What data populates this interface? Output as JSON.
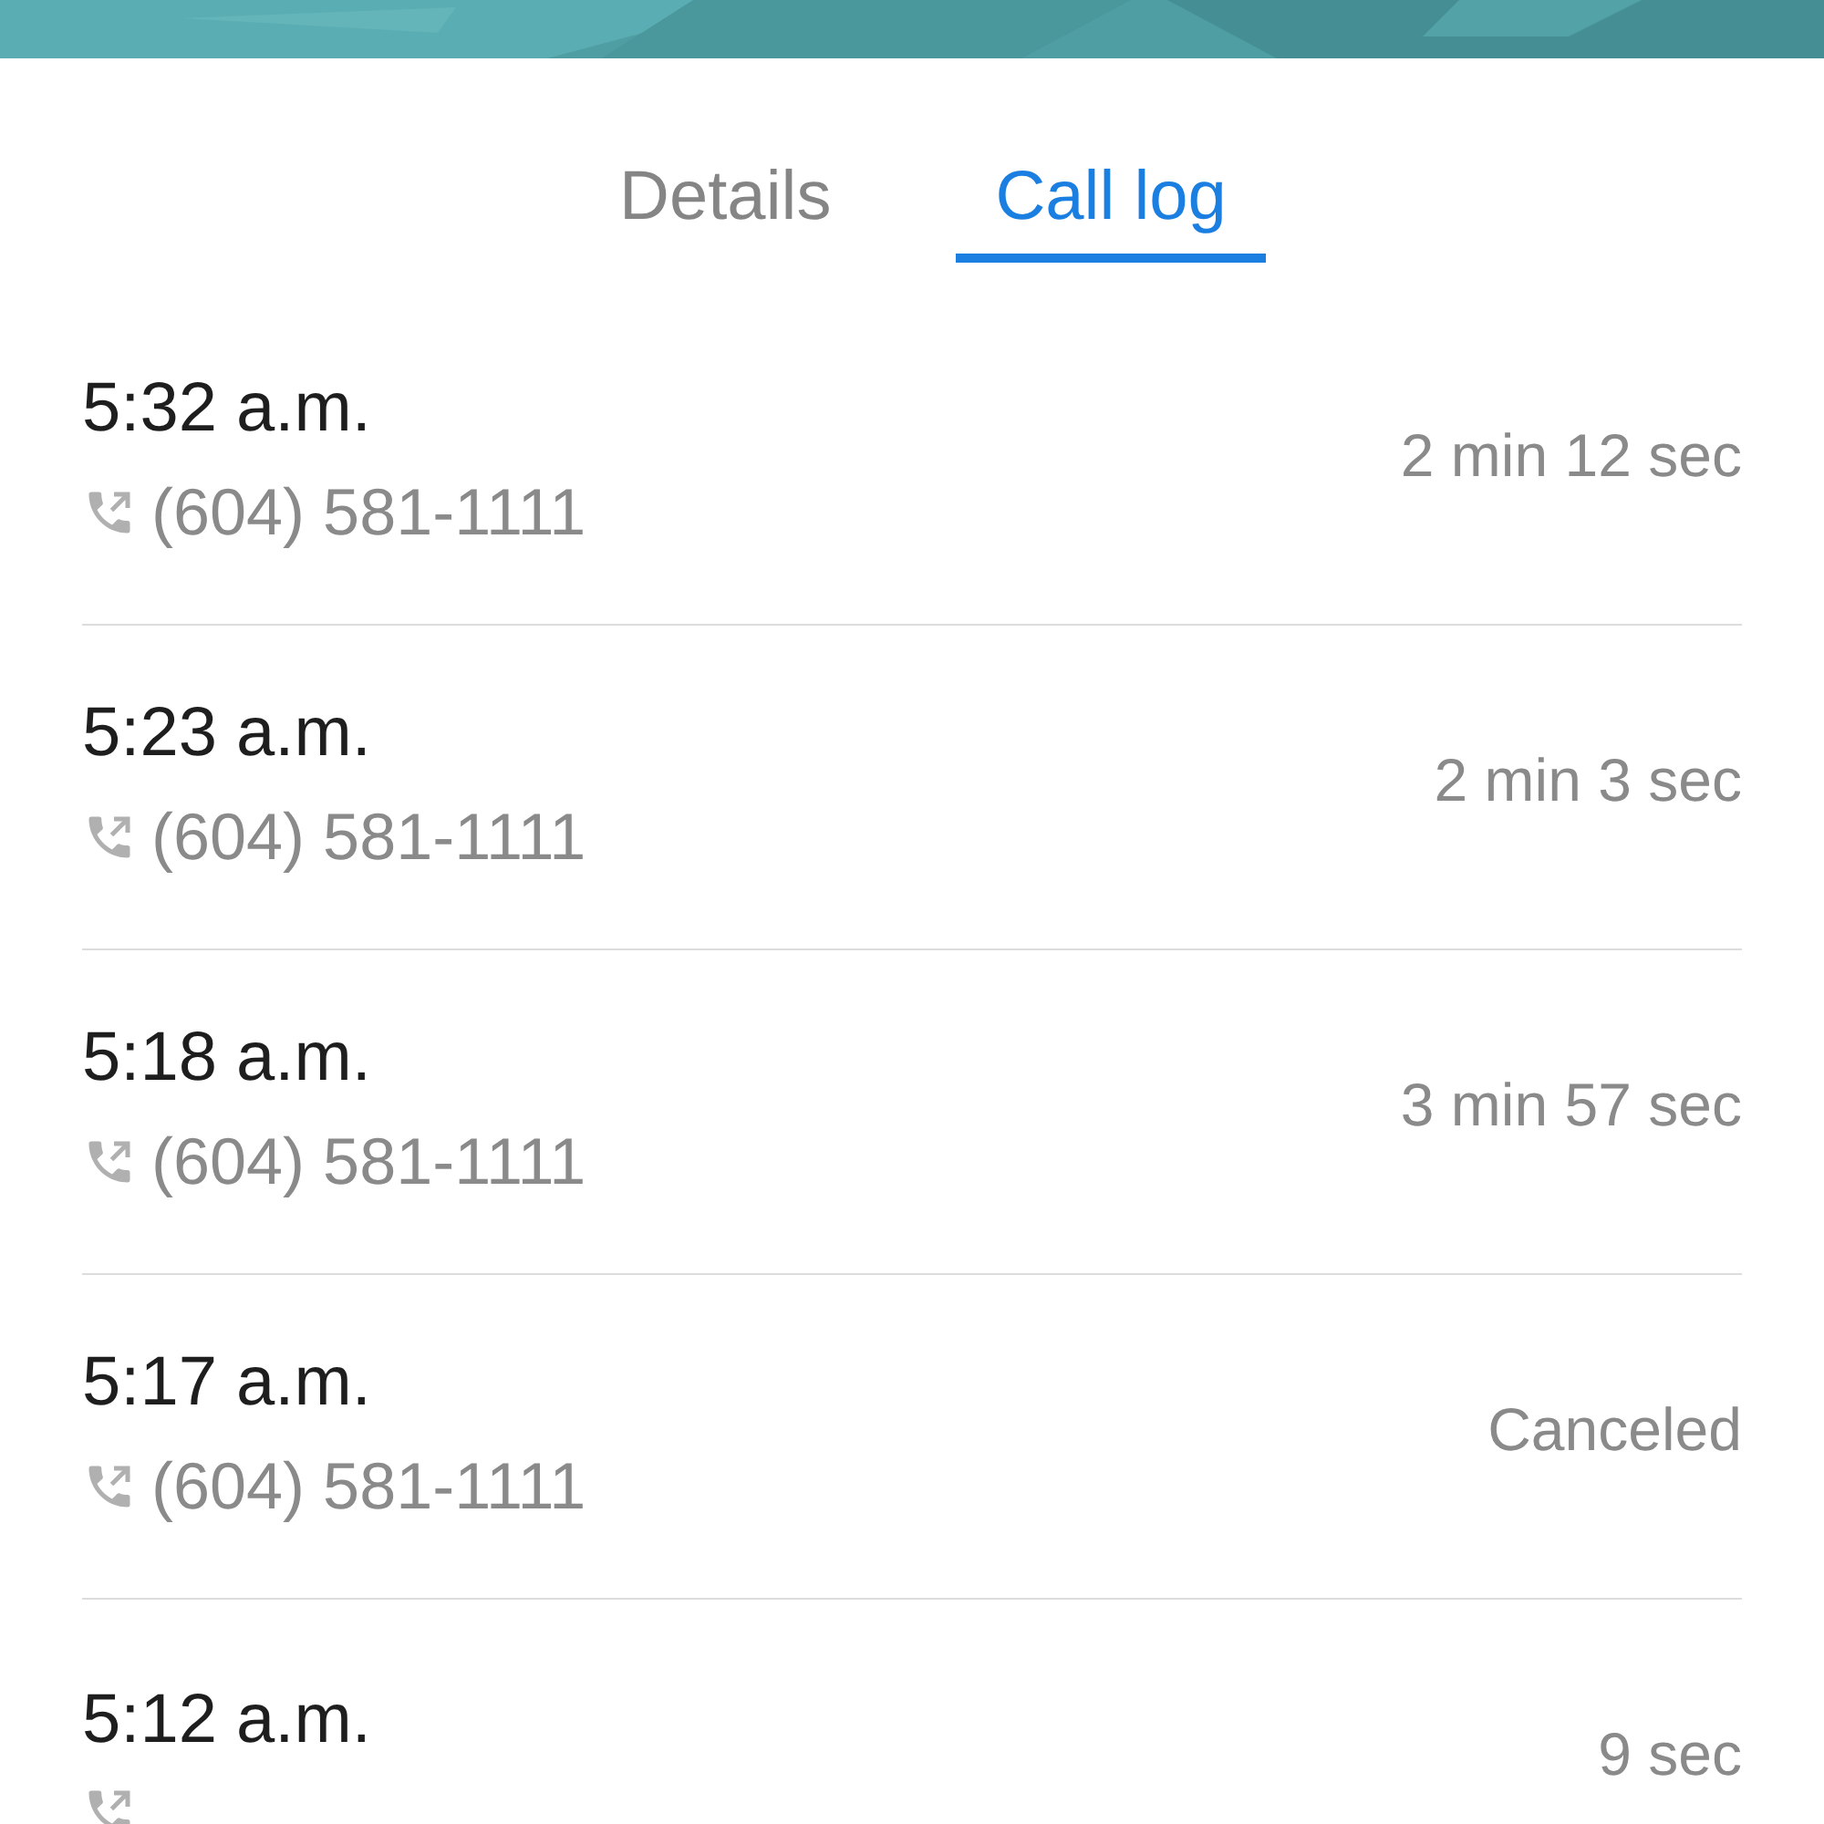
{
  "tabs": [
    {
      "label": "Details",
      "selected": false
    },
    {
      "label": "Call log",
      "selected": true
    }
  ],
  "calls": [
    {
      "time": "5:32 a.m.",
      "number": "(604) 581-1111",
      "duration": "2 min 12 sec"
    },
    {
      "time": "5:23 a.m.",
      "number": "(604) 581-1111",
      "duration": "2 min 3 sec"
    },
    {
      "time": "5:18 a.m.",
      "number": "(604) 581-1111",
      "duration": "3 min 57 sec"
    },
    {
      "time": "5:17 a.m.",
      "number": "(604) 581-1111",
      "duration": "Canceled"
    },
    {
      "time": "5:12 a.m.",
      "duration": "9 sec"
    }
  ]
}
